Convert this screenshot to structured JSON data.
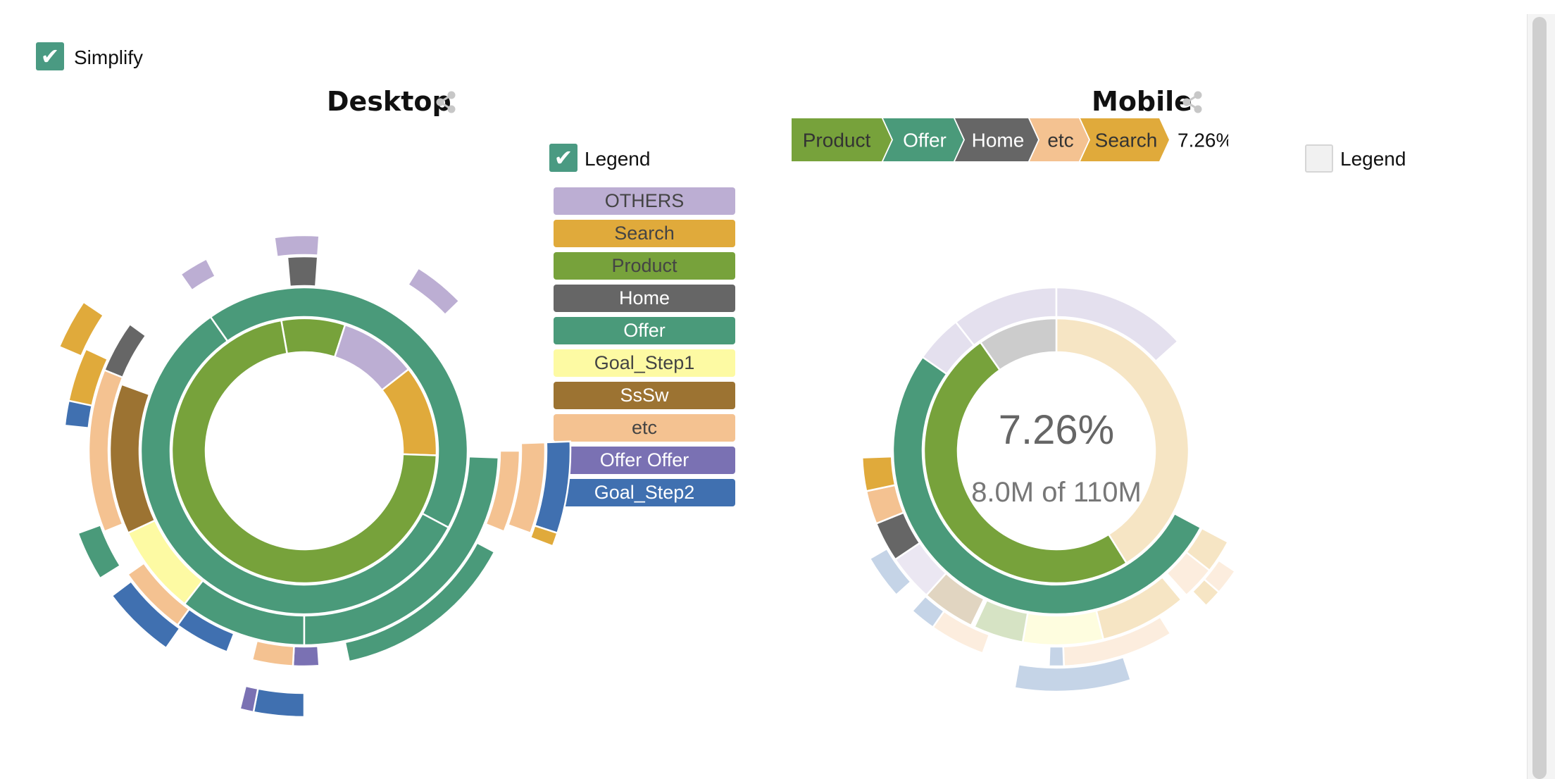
{
  "simplify": {
    "label": "Simplify",
    "checked": true
  },
  "desktop": {
    "title": "Desktop",
    "legend_label": "Legend",
    "legend_checked": true,
    "legend_items": [
      {
        "label": "OTHERS",
        "color": "#bcaed3",
        "text_color": "#444444"
      },
      {
        "label": "Search",
        "color": "#e0aa3b",
        "text_color": "#444444"
      },
      {
        "label": "Product",
        "color": "#77a23b",
        "text_color": "#444444"
      },
      {
        "label": "Home",
        "color": "#666666",
        "text_color": "#ffffff"
      },
      {
        "label": "Offer",
        "color": "#4a9a7a",
        "text_color": "#ffffff"
      },
      {
        "label": "Goal_Step1",
        "color": "#fdfaa3",
        "text_color": "#444444"
      },
      {
        "label": "SsSw",
        "color": "#9c7332",
        "text_color": "#ffffff"
      },
      {
        "label": "etc",
        "color": "#f4c291",
        "text_color": "#444444"
      },
      {
        "label": "Offer Offer",
        "color": "#7a71b3",
        "text_color": "#ffffff"
      },
      {
        "label": "Goal_Step2",
        "color": "#4070b0",
        "text_color": "#ffffff"
      }
    ]
  },
  "mobile": {
    "title": "Mobile",
    "legend_label": "Legend",
    "legend_checked": false,
    "breadcrumb": [
      {
        "label": "Product",
        "color": "#77a23b",
        "text_color": "#333333"
      },
      {
        "label": "Offer",
        "color": "#4a9a7a",
        "text_color": "#ffffff"
      },
      {
        "label": "Home",
        "color": "#666666",
        "text_color": "#ffffff"
      },
      {
        "label": "etc",
        "color": "#f4c291",
        "text_color": "#333333"
      },
      {
        "label": "Search",
        "color": "#e0aa3b",
        "text_color": "#333333"
      }
    ],
    "breadcrumb_percent": "7.26%",
    "center_percent": "7.26%",
    "center_count": "8.0M of 110M"
  },
  "chart_data": [
    {
      "type": "sunburst",
      "title": "Desktop",
      "note": "Angles in degrees clockwise from 12 o'clock; rings from inner (1) to outer (6)",
      "rings": [
        {
          "ring": 1,
          "segments": [
            {
              "category": "Product",
              "start": -10,
              "end": 18
            },
            {
              "category": "OTHERS",
              "start": 18,
              "end": 52
            },
            {
              "category": "Search",
              "start": 52,
              "end": 92
            },
            {
              "category": "Product",
              "start": 92,
              "end": 350
            }
          ]
        },
        {
          "ring": 2,
          "segments": [
            {
              "category": "Offer",
              "start": -35,
              "end": 118
            },
            {
              "category": "Offer",
              "start": 118,
              "end": 325
            }
          ]
        },
        {
          "ring": 3,
          "segments": [
            {
              "category": "Home",
              "start": -5,
              "end": 4
            },
            {
              "category": "Goal_Step1",
              "start": 218,
              "end": 245
            },
            {
              "category": "SsSw",
              "start": 245,
              "end": 290
            },
            {
              "category": "Offer",
              "start": 180,
              "end": 218
            },
            {
              "category": "Offer",
              "start": 92,
              "end": 180
            }
          ]
        },
        {
          "ring": 4,
          "segments": [
            {
              "category": "OTHERS",
              "start": -35,
              "end": -27
            },
            {
              "category": "OTHERS",
              "start": -8,
              "end": 4
            },
            {
              "category": "OTHERS",
              "start": 32,
              "end": 46
            },
            {
              "category": "Search",
              "start": 90,
              "end": 112
            },
            {
              "category": "etc",
              "start": 90,
              "end": 112
            },
            {
              "category": "etc",
              "start": 248,
              "end": 292
            },
            {
              "category": "Home",
              "start": 292,
              "end": 306
            },
            {
              "category": "Offer",
              "start": 118,
              "end": 168
            },
            {
              "category": "Offer Offer",
              "start": 176,
              "end": 183
            },
            {
              "category": "etc",
              "start": 183,
              "end": 194
            },
            {
              "category": "Goal_Step2",
              "start": 201,
              "end": 216
            },
            {
              "category": "etc",
              "start": 216,
              "end": 235
            }
          ]
        },
        {
          "ring": 5,
          "segments": [
            {
              "category": "etc",
              "start": 88,
              "end": 110
            },
            {
              "category": "Search",
              "start": 276,
              "end": 295
            },
            {
              "category": "Goal_Step2",
              "start": 276,
              "end": 282
            },
            {
              "category": "Offer",
              "start": 238,
              "end": 250
            },
            {
              "category": "Goal_Step2",
              "start": 215,
              "end": 233
            }
          ]
        },
        {
          "ring": 6,
          "segments": [
            {
              "category": "Goal_Step2",
              "start": 88,
              "end": 108
            },
            {
              "category": "Search",
              "start": 108,
              "end": 111
            },
            {
              "category": "Search",
              "start": 293,
              "end": 304
            },
            {
              "category": "Goal_Step2",
              "start": 180,
              "end": 191
            },
            {
              "category": "Offer Offer",
              "start": 191,
              "end": 194
            }
          ]
        }
      ]
    },
    {
      "type": "sunburst",
      "title": "Mobile",
      "selected_path": [
        "Product",
        "Offer",
        "Home",
        "etc",
        "Search"
      ],
      "selected_percent": 7.26,
      "selected_count": "8.0M",
      "total": "110M"
    }
  ]
}
